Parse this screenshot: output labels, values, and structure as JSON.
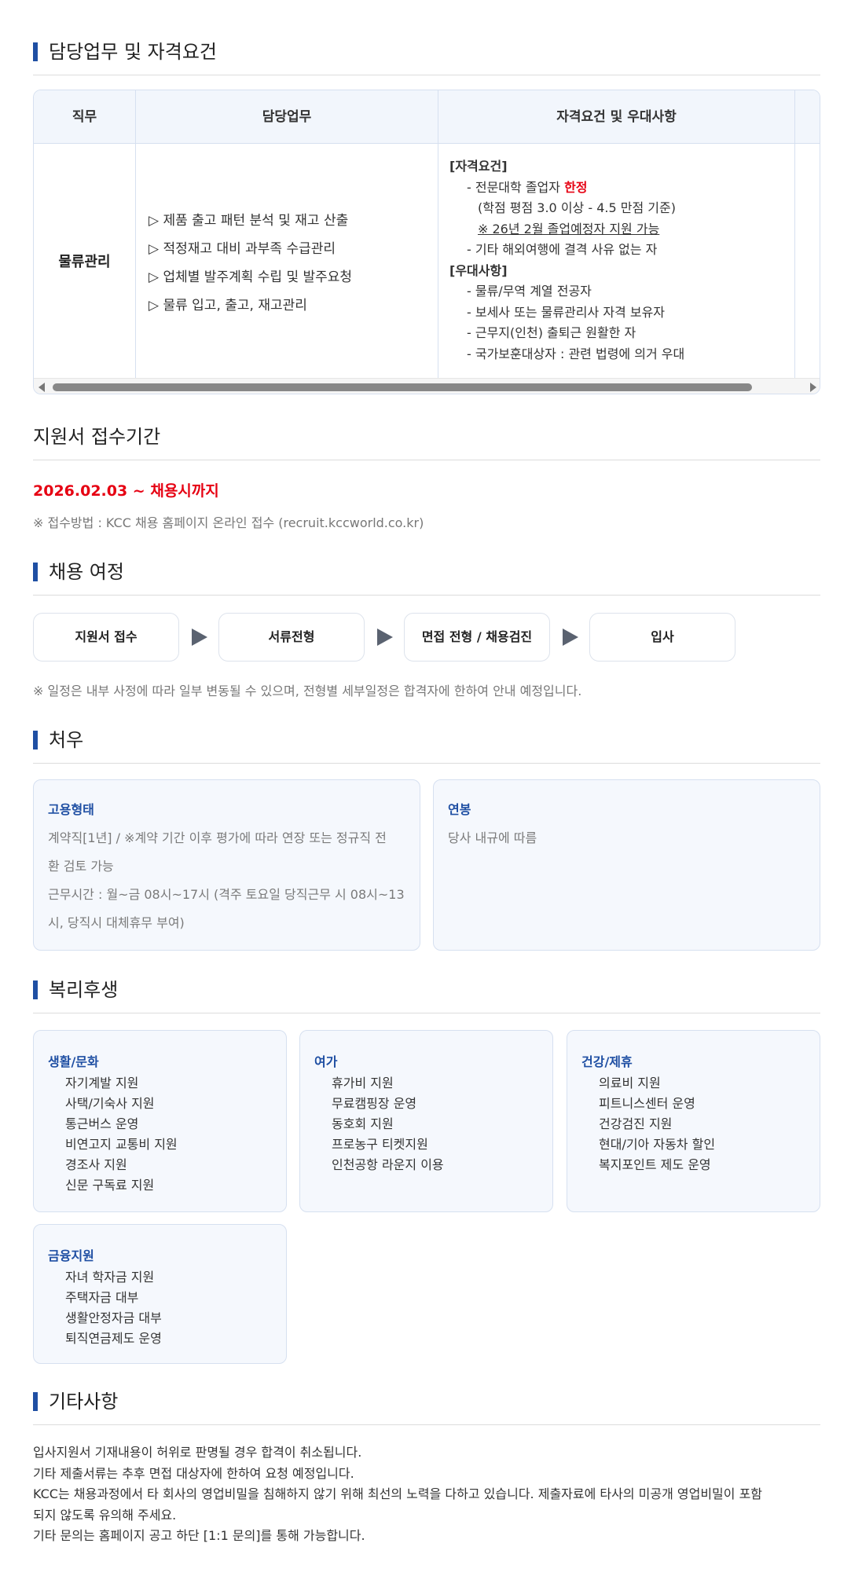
{
  "duties": {
    "title": "담당업무 및 자격요건",
    "headers": [
      "직무",
      "담당업무",
      "자격요건 및 우대사항"
    ],
    "job": "물류관리",
    "duty_items": [
      "▷ 제품 출고 패턴 분석 및 재고 산출",
      "▷ 적정재고 대비 과부족 수급관리",
      "▷ 업체별 발주계획 수립 및 발주요청",
      "▷ 물류 입고, 출고, 재고관리"
    ],
    "qual_header": "[자격요건]",
    "qual_1_prefix": "- 전문대학 졸업자 ",
    "qual_1_red": "한정",
    "qual_2": "(학점 평점 3.0 이상 - 4.5 만점 기준)",
    "qual_3": "※ 26년 2월 졸업예정자 지원 가능",
    "qual_4": "- 기타 해외여행에 결격 사유 없는 자",
    "pref_header": "[우대사항]",
    "pref_items": [
      "- 물류/무역 계열 전공자",
      "- 보세사 또는 물류관리사 자격 보유자",
      "- 근무지(인천) 출퇴근 원활한 자",
      "- 국가보훈대상자 : 관련 법령에 의거 우대"
    ]
  },
  "period": {
    "title": "지원서 접수기간",
    "date": "2026.02.03 ~ 채용시까지",
    "method": "※ 접수방법 : KCC 채용 홈페이지 온라인 접수 (recruit.kccworld.co.kr)"
  },
  "process": {
    "title": "채용 여정",
    "steps": [
      "지원서 접수",
      "서류전형",
      "면접 전형 / 채용검진",
      "입사"
    ],
    "note": "※ 일정은 내부 사정에 따라 일부 변동될 수 있으며, 전형별 세부일정은 합격자에 한하여 안내 예정입니다."
  },
  "treatment": {
    "title": "처우",
    "employment_title": "고용형태",
    "employment_lines": [
      "계약직[1년] / ※계약 기간 이후 평가에 따라 연장 또는 정규직 전",
      "환 검토 가능",
      "근무시간 : 월~금 08시~17시 (격주 토요일 당직근무 시 08시~13",
      "시, 당직시 대체휴무 부여)"
    ],
    "salary_title": "연봉",
    "salary_text": "당사 내규에 따름"
  },
  "welfare": {
    "title": "복리후생",
    "cards": [
      {
        "title": "생활/문화",
        "items": [
          "자기계발 지원",
          "사택/기숙사 지원",
          "통근버스 운영",
          "비연고지 교통비 지원",
          "경조사 지원",
          "신문 구독료 지원"
        ]
      },
      {
        "title": "여가",
        "items": [
          "휴가비 지원",
          "무료캠핑장 운영",
          "동호회 지원",
          "프로농구 티켓지원",
          "인천공항 라운지 이용"
        ]
      },
      {
        "title": "건강/제휴",
        "items": [
          "의료비 지원",
          "피트니스센터 운영",
          "건강검진 지원",
          "현대/기아 자동차 할인",
          "복지포인트 제도 운영"
        ]
      },
      {
        "title": "금융지원",
        "items": [
          "자녀 학자금 지원",
          "주택자금 대부",
          "생활안정자금 대부",
          "퇴직연금제도 운영"
        ]
      }
    ]
  },
  "etc": {
    "title": "기타사항",
    "lines": [
      "입사지원서 기재내용이 허위로 판명될 경우 합격이 취소됩니다.",
      "기타 제출서류는 추후 면접 대상자에 한하여 요청 예정입니다.",
      "KCC는 채용과정에서 타 회사의 영업비밀을 침해하지 않기 위해 최선의 노력을 다하고 있습니다. 제출자료에 타사의 미공개 영업비밀이 포함",
      "되지 않도록 유의해 주세요.",
      "기타 문의는 홈페이지 공고 하단 [1:1 문의]를 통해 가능합니다."
    ]
  },
  "colors": {
    "accent": "#1f4fa3",
    "red": "#e60012",
    "card_bg": "#f5f8fd"
  }
}
